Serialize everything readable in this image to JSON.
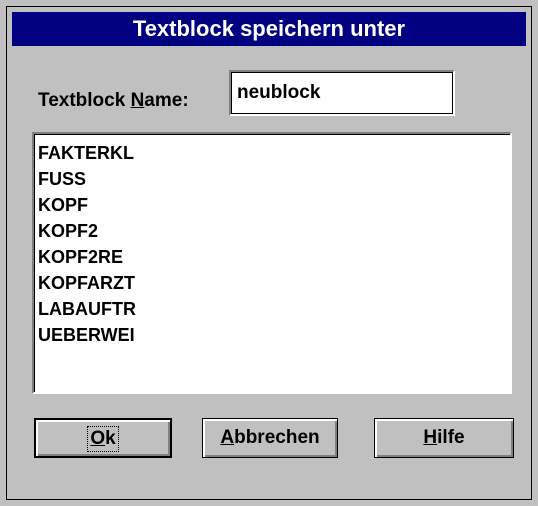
{
  "window": {
    "title": "Textblock speichern unter"
  },
  "name_field": {
    "label_pre": "Textblock ",
    "label_mnemonic": "N",
    "label_post": "ame:",
    "value": "neublock"
  },
  "list": {
    "items": [
      "FAKTERKL",
      "FUSS",
      "KOPF",
      "KOPF2",
      "KOPF2RE",
      "KOPFARZT",
      "LABAUFTR",
      "UEBERWEI"
    ]
  },
  "buttons": {
    "ok": {
      "mnemonic": "O",
      "rest": "k"
    },
    "cancel": {
      "mnemonic": "A",
      "rest": "bbrechen"
    },
    "help": {
      "mnemonic": "H",
      "rest": "ilfe"
    }
  },
  "colors": {
    "titlebar": "#000080",
    "face": "#c0c0c0",
    "text": "#000000",
    "field_bg": "#ffffff"
  }
}
